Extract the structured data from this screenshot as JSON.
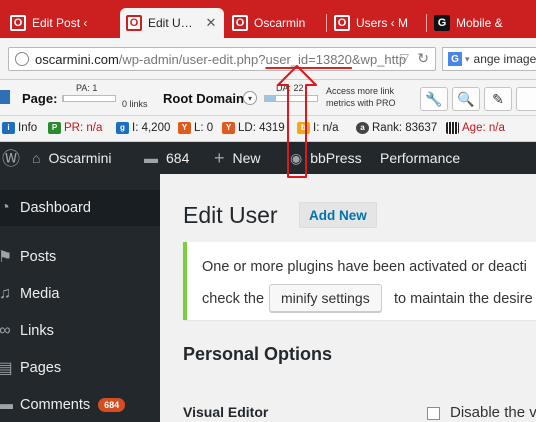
{
  "browser": {
    "tabs": [
      {
        "title": "Edit Post ‹",
        "favicon": "opera-icon",
        "active": false,
        "closable": false
      },
      {
        "title": "Edit U…",
        "favicon": "opera-icon",
        "active": true,
        "closable": true,
        "close": "✕"
      },
      {
        "title": "Oscarmin",
        "favicon": "opera-icon",
        "active": false,
        "closable": false
      },
      {
        "title": "Users ‹ M",
        "favicon": "opera-icon",
        "active": false,
        "closable": false
      },
      {
        "title": "Mobile &",
        "favicon": "g-icon",
        "active": false,
        "closable": false
      }
    ],
    "url": {
      "host": "oscarmini.com",
      "path_before": "/wp-admin/user-edit.php?",
      "highlighted": "user_id=13820",
      "path_after": "&wp_http"
    },
    "search": {
      "engine": "G",
      "value": "ange image"
    }
  },
  "seo_toolbar": {
    "page_label": "Page:",
    "pa_label": "PA: 1",
    "pa_fill": 0.01,
    "links": "0 links",
    "root_domain_label": "Root Domain:",
    "da_label": "DA: 22",
    "da_fill": 0.22,
    "access_text_1": "Access more link",
    "access_text_2": "metrics with PRO",
    "buttons": [
      "wrench-icon",
      "search-icon",
      "pencil-icon"
    ]
  },
  "metrics": {
    "info": "Info",
    "pr": "PR: n/a",
    "i1": "I: 4,200",
    "l": "L: 0",
    "ld": "LD: 4319",
    "i2": "I: n/a",
    "rank": "Rank: 83637",
    "age": "Age: n/a"
  },
  "admin_bar": {
    "site_name": "Oscarmini",
    "comments": "684",
    "new_label": "New",
    "bbpress": "bbPress",
    "performance": "Performance"
  },
  "menu": {
    "items": [
      {
        "label": "Dashboard",
        "icon": "dashboard-icon",
        "glyph": "◔"
      },
      {
        "label": "Posts",
        "icon": "pushpin-icon",
        "glyph": "⚑"
      },
      {
        "label": "Media",
        "icon": "media-icon",
        "glyph": "♫"
      },
      {
        "label": "Links",
        "icon": "link-icon",
        "glyph": "∞"
      },
      {
        "label": "Pages",
        "icon": "pages-icon",
        "glyph": "▤"
      },
      {
        "label": "Comments",
        "icon": "comment-icon",
        "glyph": "▬",
        "badge": "684"
      }
    ]
  },
  "content": {
    "title": "Edit User",
    "add_new": "Add New",
    "notice_line1": "One or more plugins have been activated or deacti",
    "notice_line2_before": "check the",
    "notice_button": "minify settings",
    "notice_line2_after": "to maintain the desire",
    "section_title": "Personal Options",
    "field_label": "Visual Editor",
    "checkbox_label": "Disable the v"
  },
  "colors": {
    "annotation": "#e0161b",
    "tab_strip": "#cc1f1f",
    "admin_bar": "#23282d",
    "notice_border": "#7ad03a",
    "link": "#0073aa",
    "badge": "#d54e21"
  }
}
